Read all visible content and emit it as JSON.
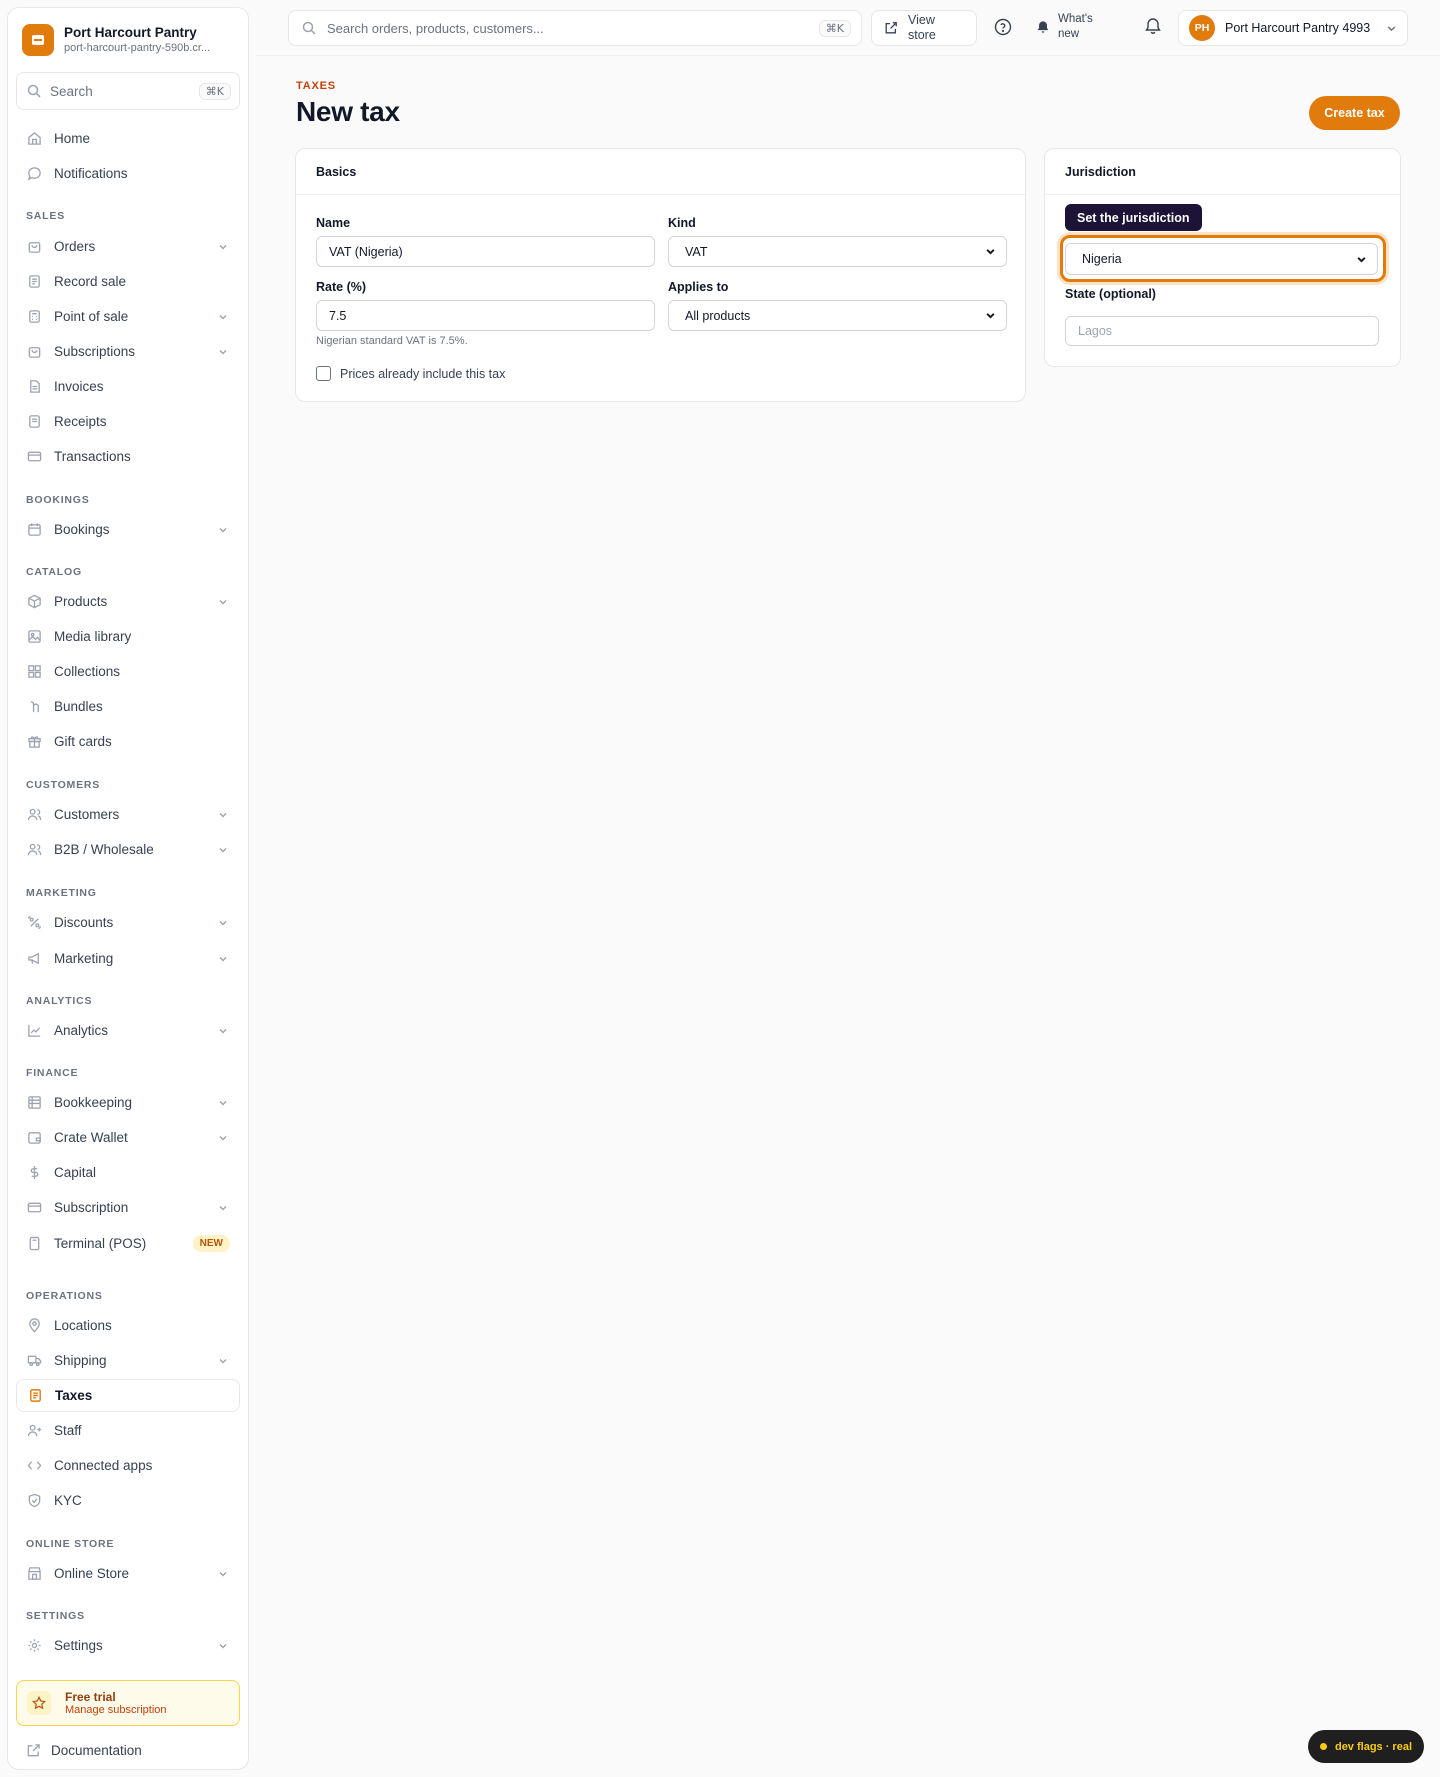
{
  "brand": {
    "name": "Port Harcourt Pantry",
    "slug": "port-harcourt-pantry-590b.cr..."
  },
  "sidebar": {
    "search_label": "Search",
    "search_shortcut": "⌘K",
    "home": "Home",
    "notifications": "Notifications",
    "sections": {
      "sales": "SALES",
      "bookings": "BOOKINGS",
      "catalog": "CATALOG",
      "customers": "CUSTOMERS",
      "marketing": "MARKETING",
      "analytics": "ANALYTICS",
      "finance": "FINANCE",
      "operations": "OPERATIONS",
      "online_store": "ONLINE STORE",
      "settings": "SETTINGS"
    },
    "items": {
      "orders": "Orders",
      "record_sale": "Record sale",
      "point_of_sale": "Point of sale",
      "subscriptions": "Subscriptions",
      "invoices": "Invoices",
      "receipts": "Receipts",
      "transactions": "Transactions",
      "bookings": "Bookings",
      "products": "Products",
      "media_library": "Media library",
      "collections": "Collections",
      "bundles": "Bundles",
      "gift_cards": "Gift cards",
      "customers": "Customers",
      "b2b": "B2B / Wholesale",
      "discounts": "Discounts",
      "marketing": "Marketing",
      "analytics": "Analytics",
      "bookkeeping": "Bookkeeping",
      "crate_wallet": "Crate Wallet",
      "capital": "Capital",
      "subscription": "Subscription",
      "terminal": "Terminal (POS)",
      "locations": "Locations",
      "shipping": "Shipping",
      "taxes": "Taxes",
      "staff": "Staff",
      "connected_apps": "Connected apps",
      "kyc": "KYC",
      "online_store": "Online Store",
      "settings": "Settings"
    },
    "terminal_badge": "NEW",
    "trial_title": "Free trial",
    "trial_sub": "Manage subscription",
    "documentation": "Documentation"
  },
  "topbar": {
    "search_placeholder": "Search orders, products, customers...",
    "search_shortcut": "⌘K",
    "view_store": "View store",
    "whats_new": "What's new",
    "account_name": "Port Harcourt Pantry 4993",
    "account_initials": "PH"
  },
  "page": {
    "eyebrow": "TAXES",
    "title": "New tax",
    "create_button": "Create tax"
  },
  "basics": {
    "heading": "Basics",
    "name_label": "Name",
    "name_value": "VAT (Nigeria)",
    "kind_label": "Kind",
    "kind_value": "VAT",
    "rate_label": "Rate (%)",
    "rate_value": "7.5",
    "rate_hint": "Nigerian standard VAT is 7.5%.",
    "applies_label": "Applies to",
    "applies_value": "All products",
    "inclusive_label": "Prices already include this tax"
  },
  "jurisdiction": {
    "heading": "Jurisdiction",
    "tooltip": "Set the jurisdiction",
    "country_value": "Nigeria",
    "state_label": "State (optional)",
    "state_placeholder": "Lagos"
  },
  "dev_flags": "dev flags · real",
  "colors": {
    "accent": "#e07b0c",
    "tooltip_bg": "#1c1336"
  }
}
